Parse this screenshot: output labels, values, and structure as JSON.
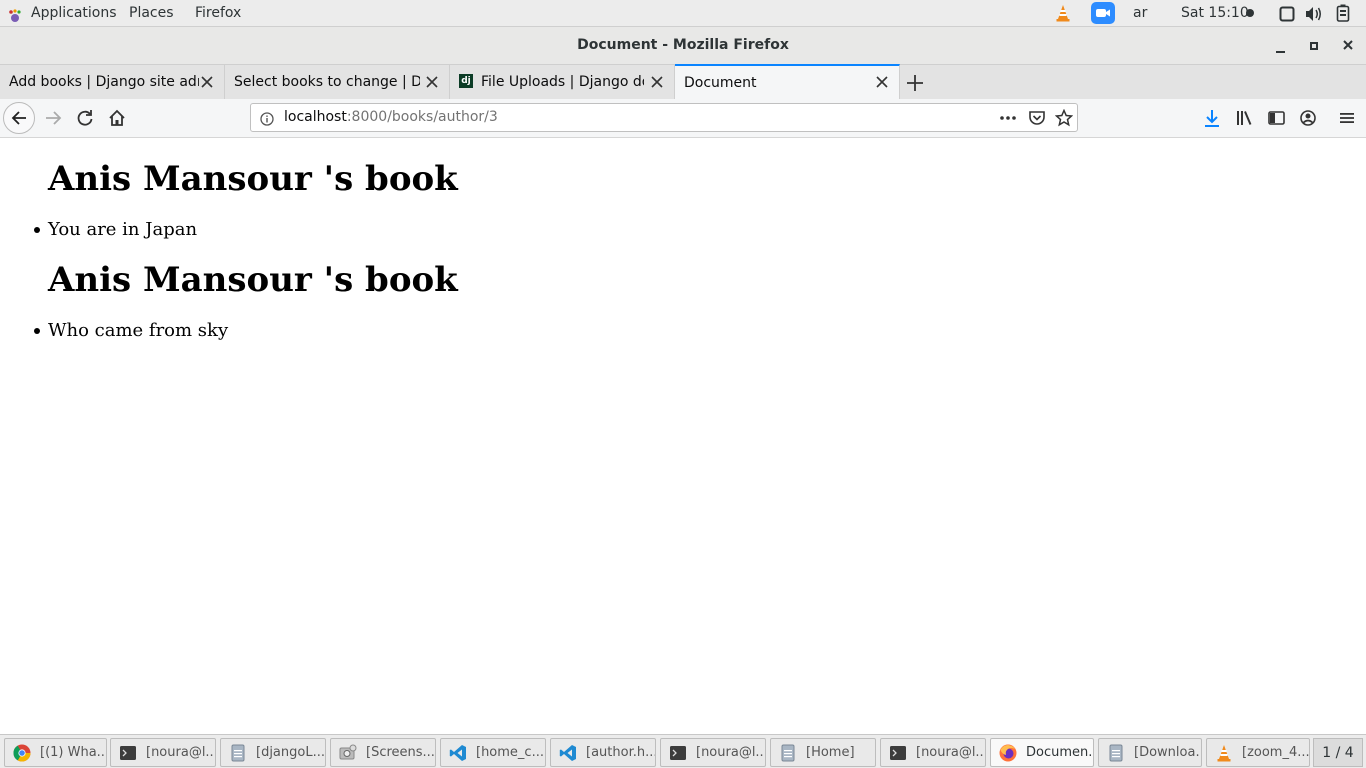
{
  "topbar": {
    "applications": "Applications",
    "places": "Places",
    "firefox": "Firefox",
    "keyboard_layout": "ar",
    "clock": "Sat 15:10",
    "icons": [
      "vlc-cone-icon",
      "zoom-camera-icon",
      "screen-icon",
      "volume-icon",
      "battery-icon"
    ]
  },
  "window": {
    "title": "Document - Mozilla Firefox",
    "controls": [
      "minimize-icon",
      "maximize-icon",
      "close-icon"
    ]
  },
  "tabs": [
    {
      "title": "Add books | Django site admin",
      "active": false
    },
    {
      "title": "Select books to change | Django site admin",
      "active": false
    },
    {
      "title": "File Uploads | Django documentation",
      "active": false,
      "favicon": "dj"
    },
    {
      "title": "Document",
      "active": true
    }
  ],
  "navbar": {
    "url_host": "localhost",
    "url_path": ":8000/books/author/3"
  },
  "page": {
    "sections": [
      {
        "heading": "Anis Mansour 's book",
        "items": [
          "You are in Japan"
        ]
      },
      {
        "heading": "Anis Mansour 's book",
        "items": [
          "Who came from sky"
        ]
      }
    ]
  },
  "taskbar": {
    "items": [
      {
        "label": "[(1) Wha...",
        "icon": "chrome-icon"
      },
      {
        "label": "[noura@l...",
        "icon": "terminal-icon"
      },
      {
        "label": "[djangoL...",
        "icon": "file-icon"
      },
      {
        "label": "[Screens...",
        "icon": "screenshot-icon"
      },
      {
        "label": "[home_c...",
        "icon": "vscode-icon"
      },
      {
        "label": "[author.h...",
        "icon": "vscode-icon"
      },
      {
        "label": "[noura@l...",
        "icon": "terminal-icon"
      },
      {
        "label": "[Home]",
        "icon": "file-icon"
      },
      {
        "label": "[noura@l...",
        "icon": "terminal-icon"
      },
      {
        "label": "Documen...",
        "icon": "firefox-icon",
        "active": true
      },
      {
        "label": "[Downloa...",
        "icon": "file-icon"
      },
      {
        "label": "[zoom_4...",
        "icon": "vlc-cone-icon"
      }
    ],
    "workspace": "1 / 4"
  },
  "colors": {
    "accent": "#0a84ff",
    "download": "#0a84ff"
  }
}
